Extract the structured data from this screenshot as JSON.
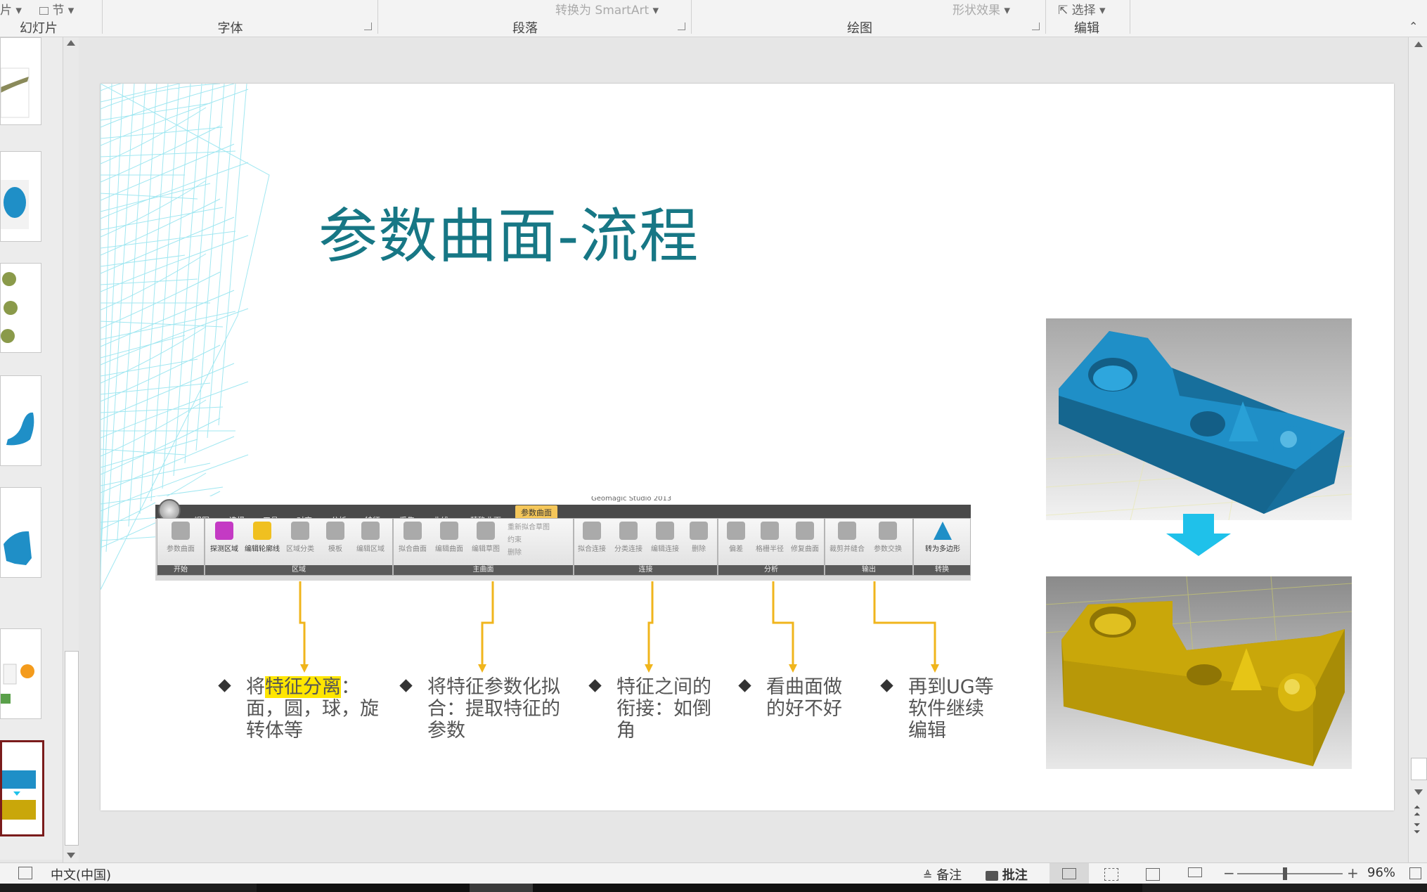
{
  "ribbon": {
    "top_slides_label": "幻灯片",
    "top_section_label": "节",
    "top_smartart_label": "转换为 SmartArt",
    "top_shape_effects_label": "形状效果",
    "top_select_label": "选择",
    "groups": [
      "幻灯片",
      "字体",
      "段落",
      "绘图",
      "编辑"
    ]
  },
  "slide": {
    "title": "参数曲面-流程",
    "title_color": "#177785",
    "bullets": [
      {
        "prefix": "将",
        "highlight": "特征分离",
        "rest": "：面，圆，球，旋转体等"
      },
      {
        "text": "将特征参数化拟合：提取特征的参数"
      },
      {
        "text": "特征之间的衔接：如倒角"
      },
      {
        "text": "看曲面做的好不好"
      },
      {
        "text": "再到UG等软件继续编辑"
      }
    ],
    "connector_color": "#f0b51c",
    "arrow_color": "#1fc1ea",
    "model_colors": {
      "top": "#1f8fc7",
      "bottom": "#c9a70a"
    },
    "embedded_toolbar": {
      "header_text": "Geomagic Studio 2013",
      "tabs": [
        "视图",
        "选择",
        "工具",
        "对齐",
        "分析",
        "特征",
        "采集",
        "曲线",
        "精确曲面",
        "参数曲面"
      ],
      "groups": [
        {
          "label": "开始",
          "buttons": [
            "参数曲面"
          ]
        },
        {
          "label": "区域",
          "buttons": [
            "探测区域",
            "编辑轮廓线",
            "区域分类",
            "模板",
            "编辑区域"
          ]
        },
        {
          "label": "主曲面",
          "buttons": [
            "拟合曲面",
            "编辑曲面",
            "编辑草图"
          ],
          "small_buttons": [
            "重新拟合草图",
            "约束",
            "删除"
          ]
        },
        {
          "label": "连接",
          "buttons": [
            "拟合连接",
            "分类连接",
            "编辑连接",
            "删除"
          ]
        },
        {
          "label": "分析",
          "buttons": [
            "偏差",
            "格栅半径",
            "修复曲面"
          ]
        },
        {
          "label": "输出",
          "buttons": [
            "裁剪并缝合",
            "参数交换"
          ]
        },
        {
          "label": "转换",
          "buttons": [
            "转为多边形"
          ]
        }
      ]
    }
  },
  "status": {
    "language": "中文(中国)",
    "notes_label": "备注",
    "comments_label": "批注",
    "zoom": "96%",
    "zoom_value_pct": 96
  },
  "icons": [
    "scroll-up-icon",
    "scroll-down-icon",
    "notes-icon",
    "comment-icon",
    "normal-view-icon",
    "slide-sorter-icon",
    "reading-view-icon",
    "slideshow-icon",
    "fit-slide-icon",
    "zoom-out-icon",
    "zoom-in-icon",
    "cursor-icon",
    "section-icon",
    "spellcheck-icon",
    "prev-slide-icon",
    "next-slide-icon",
    "diamond-bullet-icon",
    "down-arrow-icon"
  ]
}
